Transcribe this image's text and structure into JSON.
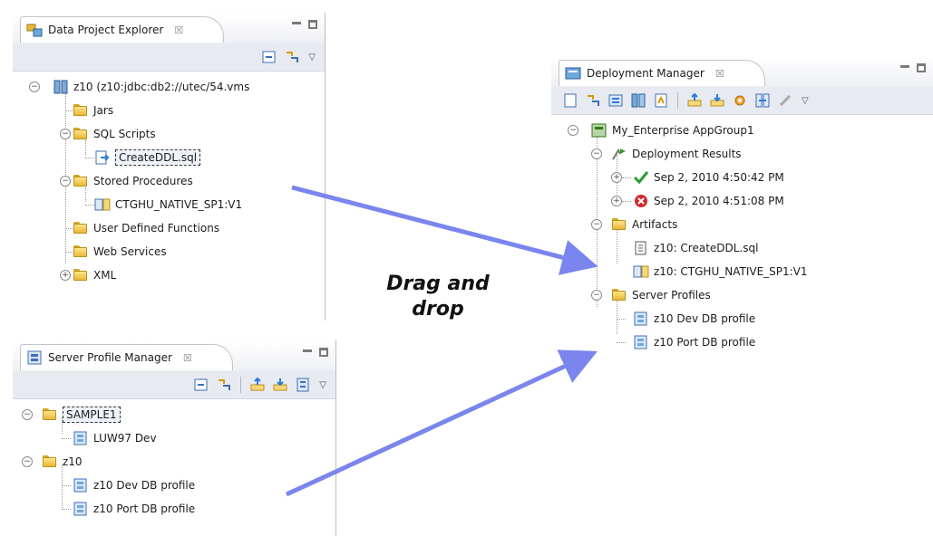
{
  "data_project_explorer": {
    "title": "Data Project Explorer",
    "close_glyph": "☒",
    "tree": [
      {
        "label": "z10 (z10:jdbc:db2://utec/54.vms",
        "icon": "database-connection-icon"
      },
      {
        "label": "Jars",
        "icon": "folder-icon"
      },
      {
        "label": "SQL Scripts",
        "icon": "folder-icon"
      },
      {
        "label": "CreateDDL.sql",
        "icon": "sql-script-icon"
      },
      {
        "label": "Stored Procedures",
        "icon": "folder-icon"
      },
      {
        "label": "CTGHU_NATIVE_SP1:V1",
        "icon": "stored-procedure-icon"
      },
      {
        "label": "User Defined Functions",
        "icon": "folder-icon"
      },
      {
        "label": "Web Services",
        "icon": "folder-icon"
      },
      {
        "label": "XML",
        "icon": "folder-icon"
      }
    ]
  },
  "server_profile_manager": {
    "title": "Server Profile Manager",
    "close_glyph": "☒",
    "tree": [
      {
        "label": "SAMPLE1",
        "icon": "folder-open-icon"
      },
      {
        "label": "LUW97 Dev",
        "icon": "server-profile-icon"
      },
      {
        "label": "z10",
        "icon": "folder-open-icon"
      },
      {
        "label": "z10 Dev DB profile",
        "icon": "server-profile-icon"
      },
      {
        "label": "z10 Port DB profile",
        "icon": "server-profile-icon"
      }
    ]
  },
  "deployment_manager": {
    "title": "Deployment Manager",
    "close_glyph": "☒",
    "tree": [
      {
        "label": "My_Enterprise AppGroup1",
        "icon": "deployment-group-icon"
      },
      {
        "label": "Deployment Results",
        "icon": "deployment-results-icon"
      },
      {
        "label": "Sep 2, 2010 4:50:42 PM",
        "icon": "success-check-icon"
      },
      {
        "label": "Sep 2, 2010 4:51:08 PM",
        "icon": "error-icon"
      },
      {
        "label": "Artifacts",
        "icon": "folder-open-icon"
      },
      {
        "label": "z10: CreateDDL.sql",
        "icon": "sql-file-icon"
      },
      {
        "label": "z10: CTGHU_NATIVE_SP1:V1",
        "icon": "stored-procedure-icon"
      },
      {
        "label": "Server Profiles",
        "icon": "folder-open-icon"
      },
      {
        "label": "z10 Dev DB profile",
        "icon": "server-profile-icon"
      },
      {
        "label": "z10 Port DB profile",
        "icon": "server-profile-icon"
      }
    ]
  },
  "caption": {
    "line1": "Drag and",
    "line2": "drop"
  },
  "colors": {
    "arrow": "#7a86ee",
    "toolbar_bg": "#e7eaf0",
    "folder": "#f2c94c"
  }
}
